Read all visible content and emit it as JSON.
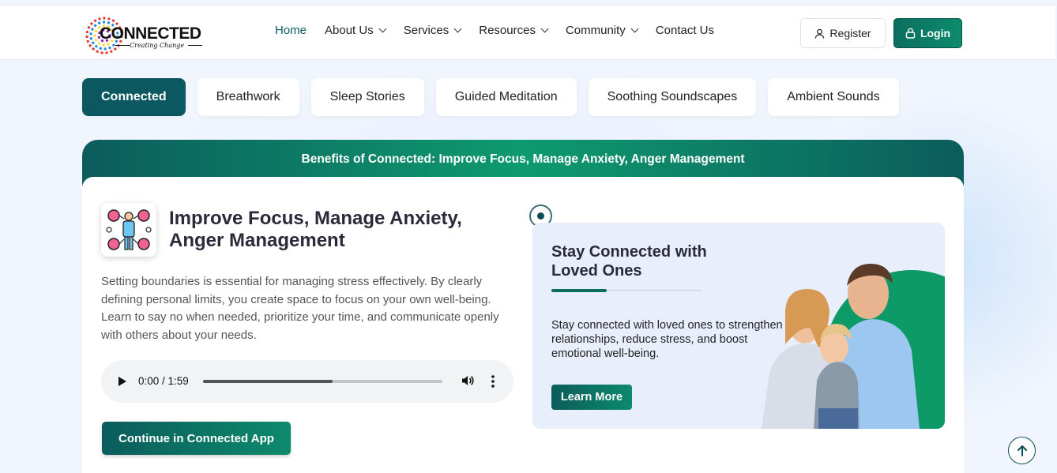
{
  "brand": {
    "name": "CONNECTED",
    "tagline": "Creating Change"
  },
  "nav": {
    "home": "Home",
    "about": "About Us",
    "services": "Services",
    "resources": "Resources",
    "community": "Community",
    "contact": "Contact Us"
  },
  "auth": {
    "register": "Register",
    "login": "Login"
  },
  "tabs": [
    "Connected",
    "Breathwork",
    "Sleep Stories",
    "Guided Meditation",
    "Soothing Soundscapes",
    "Ambient Sounds"
  ],
  "card": {
    "header": "Benefits of Connected: Improve Focus, Manage Anxiety, Anger Management",
    "title": "Improve Focus, Manage Anxiety, Anger Management",
    "description": "Setting boundaries is essential for managing stress effectively. By clearly defining personal limits, you create space to focus on your own well-being. Learn to say no when needed, prioritize your time, and communicate openly with others about your needs.",
    "audio": {
      "time": "0:00 / 1:59",
      "progress": 0.54
    },
    "continue": "Continue in Connected App"
  },
  "promo": {
    "title": "Stay Connected with Loved Ones",
    "text": "Stay connected with loved ones to strengthen relationships, reduce stress, and boost emotional well-being.",
    "cta": "Learn More"
  },
  "colors": {
    "primary": "#0b5860",
    "accent": "#0d8a6c"
  },
  "icons": [
    "user-icon",
    "lock-icon",
    "play-icon",
    "volume-icon",
    "more-vertical-icon",
    "arrow-up-icon",
    "emotions-person-icon"
  ]
}
